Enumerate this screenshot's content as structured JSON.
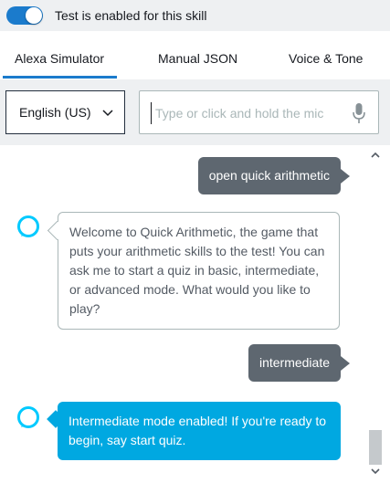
{
  "toggle": {
    "label": "Test is enabled for this skill",
    "enabled": true,
    "accent": "#1b7bcc"
  },
  "tabs": [
    {
      "label": "Alexa Simulator",
      "active": true
    },
    {
      "label": "Manual JSON",
      "active": false
    },
    {
      "label": "Voice & Tone",
      "active": false
    }
  ],
  "language": {
    "selected": "English (US)",
    "icon": "chevron-down-icon"
  },
  "utterance": {
    "placeholder": "Type or click and hold the mic",
    "value": "",
    "icon": "microphone-icon"
  },
  "conversation": {
    "messages": [
      {
        "sender": "user",
        "text": "open quick arithmetic"
      },
      {
        "sender": "alexa",
        "text": "Welcome to Quick Arithmetic, the game that puts your arithmetic skills to the test! You can ask me to start a quiz in basic, intermediate, or advanced mode. What would you like to play?"
      },
      {
        "sender": "user",
        "text": "intermediate"
      },
      {
        "sender": "alexa",
        "text": "Intermediate mode enabled! If you're ready to begin, say start quiz."
      }
    ]
  },
  "colors": {
    "user_bubble": "#5e6770",
    "alexa_active_bubble": "#00a8e1",
    "alexa_icon": "#00caff"
  }
}
